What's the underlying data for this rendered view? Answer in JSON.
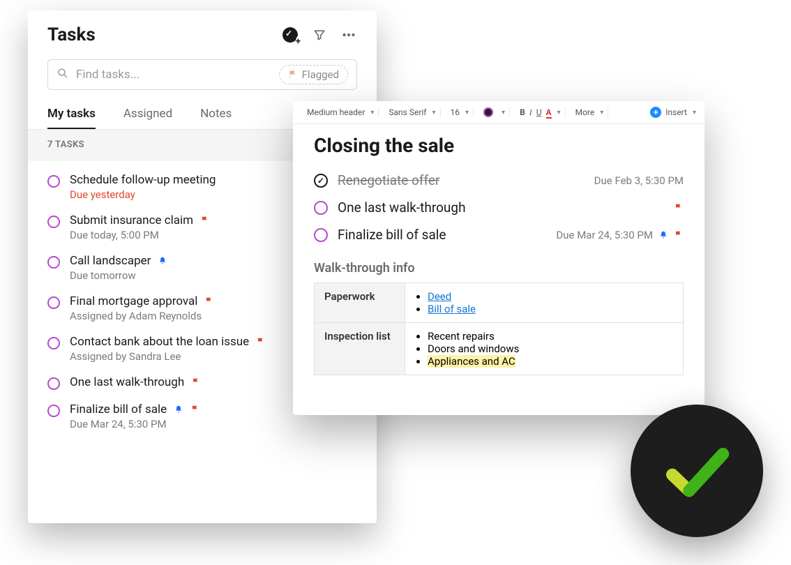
{
  "tasks_panel": {
    "title": "Tasks",
    "search_placeholder": "Find tasks...",
    "flagged_chip": "Flagged",
    "tabs": {
      "my_tasks": "My tasks",
      "assigned": "Assigned",
      "notes": "Notes"
    },
    "section_label": "7 TASKS",
    "items": [
      {
        "title": "Schedule follow-up meeting",
        "sub": "Due yesterday",
        "sub_red": true
      },
      {
        "title": "Submit insurance claim",
        "sub": "Due today, 5:00 PM",
        "flag": true
      },
      {
        "title": "Call landscaper",
        "sub": "Due tomorrow",
        "bell": true
      },
      {
        "title": "Final mortgage approval",
        "sub": "Assigned by Adam Reynolds",
        "flag": true
      },
      {
        "title": "Contact bank about the loan issue",
        "sub": "Assigned by Sandra Lee",
        "flag": true
      },
      {
        "title": "One last walk-through",
        "flag": true
      },
      {
        "title": "Finalize bill of sale",
        "sub": "Due Mar 24, 5:30 PM",
        "bell": true,
        "flag": true
      }
    ]
  },
  "doc": {
    "toolbar": {
      "heading": "Medium header",
      "font": "Sans Serif",
      "size": "16",
      "more": "More",
      "insert": "Insert"
    },
    "title": "Closing the sale",
    "tasks": [
      {
        "done": true,
        "title": "Renegotiate offer",
        "due": "Due Feb 3, 5:30 PM"
      },
      {
        "done": false,
        "title": "One last walk-through",
        "flag": true
      },
      {
        "done": false,
        "title": "Finalize bill of sale",
        "due": "Due Mar 24, 5:30 PM",
        "bell": true,
        "flag": true
      }
    ],
    "section_heading": "Walk-through info",
    "table": {
      "paperwork_label": "Paperwork",
      "paperwork_links": {
        "deed": "Deed",
        "bos": "Bill of sale"
      },
      "inspection_label": "Inspection list",
      "inspection_items": {
        "a": "Recent repairs",
        "b": "Doors and windows",
        "c": "Appliances and AC"
      }
    }
  }
}
